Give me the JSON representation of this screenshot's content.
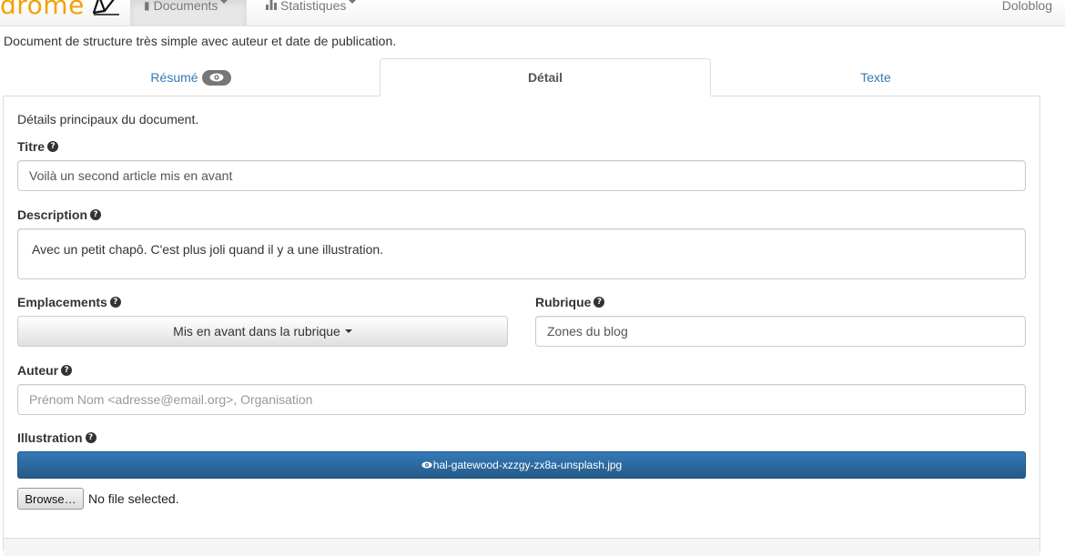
{
  "navbar": {
    "brand": "drome",
    "documents_label": "Documents",
    "stats_label": "Statistiques",
    "site_label": "Doloblog"
  },
  "intro": "Document de structure très simple avec auteur et date de publication.",
  "tabs": [
    {
      "label": "Résumé"
    },
    {
      "label": "Détail"
    },
    {
      "label": "Texte"
    }
  ],
  "form": {
    "description_text": "Détails principaux du document.",
    "titre_label": "Titre",
    "titre_value": "Voilà un second article mis en avant",
    "description_label": "Description",
    "description_value": "Avec un petit chapô. C'est plus joli quand il y a une illustration.",
    "emplacements_label": "Emplacements",
    "emplacements_value": "Mis en avant dans la rubrique",
    "rubrique_label": "Rubrique",
    "rubrique_value": "Zones du blog",
    "auteur_label": "Auteur",
    "auteur_placeholder": "Prénom Nom <adresse@email.org>, Organisation",
    "illustration_label": "Illustration",
    "illustration_file": "hal-gatewood-xzzgy-zx8a-unsplash.jpg",
    "browse_label": "Browse…",
    "no_file": "No file selected."
  },
  "colors": {
    "brand": "#f0a30a",
    "link": "#337ab7",
    "primary": "#337ab7"
  }
}
